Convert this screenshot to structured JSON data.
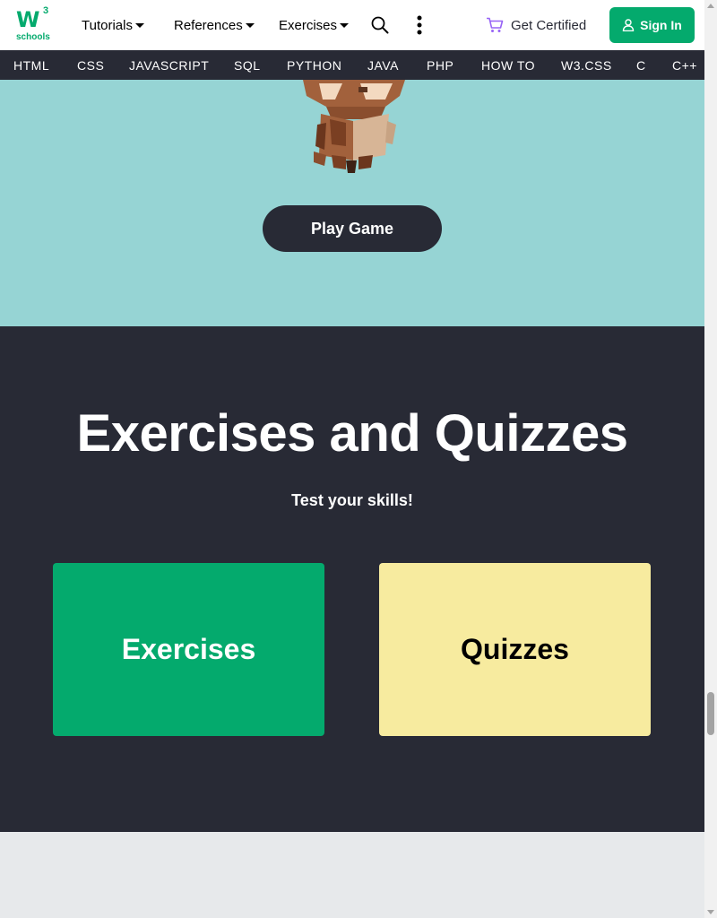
{
  "header": {
    "logo_main": "W",
    "logo_superscript": "3",
    "logo_sub": "schools",
    "nav": {
      "tutorials": "Tutorials",
      "references": "References",
      "exercises": "Exercises"
    },
    "get_certified": "Get Certified",
    "sign_in": "Sign In"
  },
  "subnav": {
    "items": [
      "HTML",
      "CSS",
      "JAVASCRIPT",
      "SQL",
      "PYTHON",
      "JAVA",
      "PHP",
      "HOW TO",
      "W3.CSS",
      "C",
      "C++"
    ]
  },
  "game": {
    "play_button": "Play Game"
  },
  "exercises_section": {
    "title": "Exercises and Quizzes",
    "subtitle": "Test your skills!",
    "cards": {
      "exercises": "Exercises",
      "quizzes": "Quizzes"
    }
  },
  "colors": {
    "brand_green": "#04aa6d",
    "dark": "#282a35",
    "teal": "#96d4d4",
    "yellow": "#f7eb9f",
    "light_gray": "#e7e9eb"
  },
  "icons": [
    "search-icon",
    "more-vertical-icon",
    "cart-icon",
    "user-icon"
  ]
}
